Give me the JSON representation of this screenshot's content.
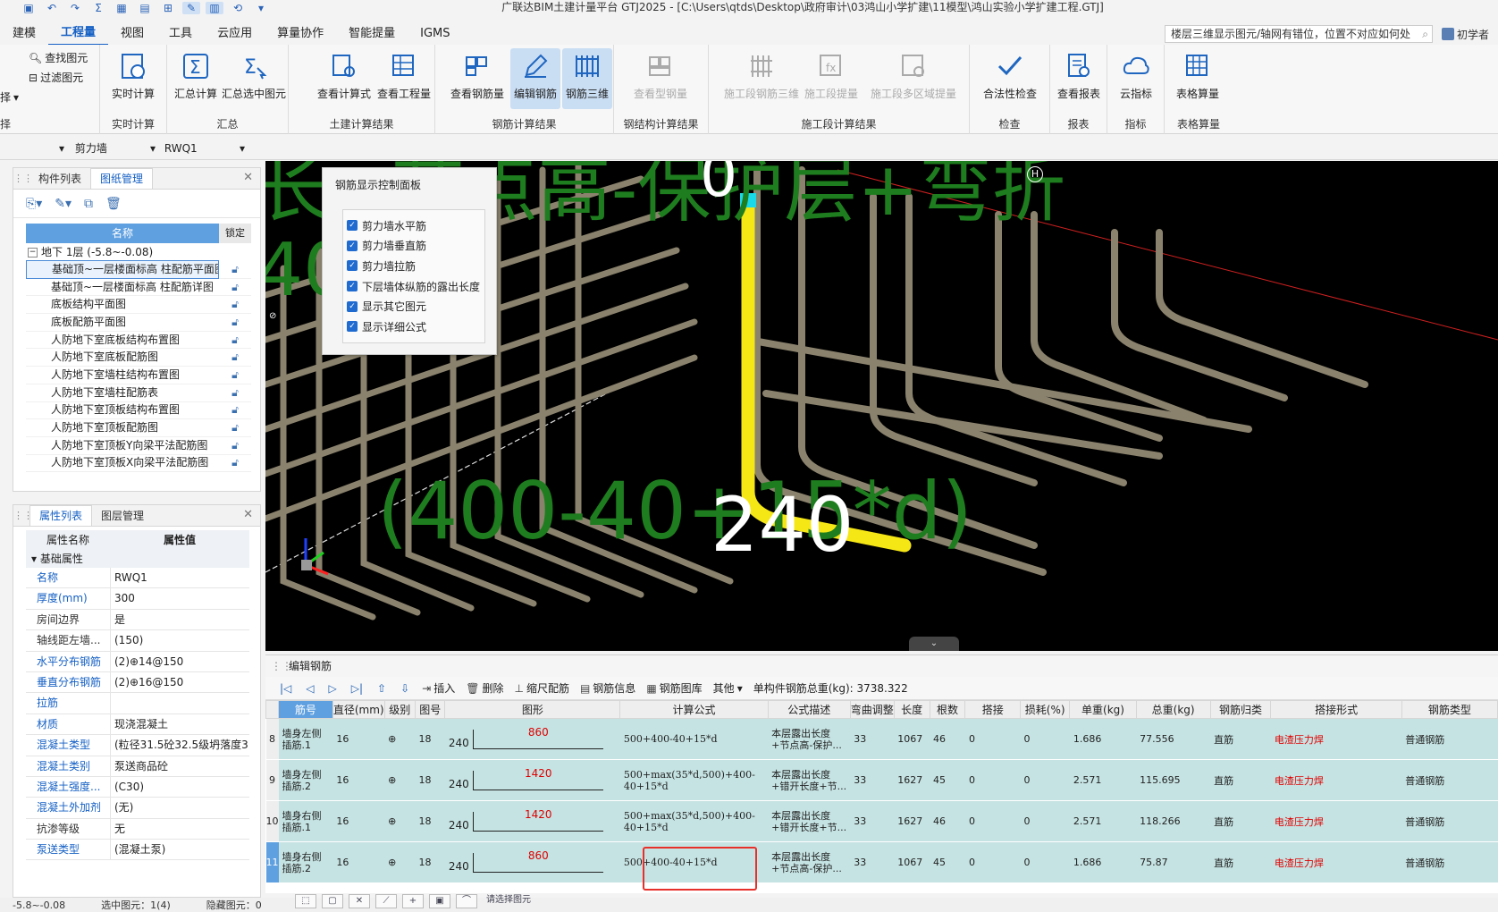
{
  "window": {
    "title": "广联达BIM土建计量平台 GTJ2025 - [C:\\Users\\qtds\\Desktop\\政府审计\\03鸿山小学扩建\\11模型\\鸿山实验小学扩建工程.GTJ]"
  },
  "menu": {
    "items": [
      "建模",
      "工程量",
      "视图",
      "工具",
      "云应用",
      "算量协作",
      "智能提量",
      "IGMS"
    ],
    "active": "工程量",
    "help_text": "楼层三维显示图元/轴网有错位，位置不对应如何处理?",
    "user": "初学者"
  },
  "ribbon": {
    "left_small": [
      "查找图元",
      "过滤图元"
    ],
    "left_cut": [
      "择",
      "择"
    ],
    "groups": [
      {
        "name": "实时计算",
        "buttons": [
          "实时计算"
        ]
      },
      {
        "name": "汇总",
        "buttons": [
          "汇总计算",
          "汇总选中图元"
        ]
      },
      {
        "name": "土建计算结果",
        "buttons": [
          "查看计算式",
          "查看工程量"
        ]
      },
      {
        "name": "钢筋计算结果",
        "buttons": [
          "查看钢筋量",
          "编辑钢筋",
          "钢筋三维"
        ]
      },
      {
        "name": "钢结构计算结果",
        "buttons": [
          "查看型钢量"
        ]
      },
      {
        "name": "施工段计算结果",
        "buttons": [
          "施工段钢筋三维",
          "施工段提量",
          "施工段多区域提量"
        ]
      },
      {
        "name": "检查",
        "buttons": [
          "合法性检查"
        ]
      },
      {
        "name": "报表",
        "buttons": [
          "查看报表"
        ]
      },
      {
        "name": "指标",
        "buttons": [
          "云指标"
        ]
      },
      {
        "name": "表格算量",
        "buttons": [
          "表格算量"
        ]
      }
    ]
  },
  "selector": {
    "type": "剪力墙",
    "element": "RWQ1"
  },
  "drawing_panel": {
    "tabs": [
      "构件列表",
      "图纸管理"
    ],
    "active_tab": "图纸管理",
    "col_name": "名称",
    "col_lock": "锁定",
    "floor": "地下 1层 (-5.8~-0.08)",
    "drawings": [
      "基础顶~一层楼面标高 柱配筋平面图",
      "基础顶~一层楼面标高 柱配筋详图",
      "底板结构平面图",
      "底板配筋平面图",
      "人防地下室底板结构布置图",
      "人防地下室底板配筋图",
      "人防地下室墙柱结构布置图",
      "人防地下室墙柱配筋表",
      "人防地下室顶板结构布置图",
      "人防地下室顶板配筋图",
      "人防地下室顶板Y向梁平法配筋图",
      "人防地下室顶板X向梁平法配筋图"
    ]
  },
  "property_panel": {
    "tabs": [
      "属性列表",
      "图层管理"
    ],
    "active_tab": "属性列表",
    "col_name": "属性名称",
    "col_value": "属性值",
    "group": "基础属性",
    "rows": [
      {
        "k": "名称",
        "v": "RWQ1",
        "blue": true
      },
      {
        "k": "厚度(mm)",
        "v": "300",
        "blue": true
      },
      {
        "k": "房间边界",
        "v": "是",
        "blue": false
      },
      {
        "k": "轴线距左墙...",
        "v": "(150)",
        "blue": false
      },
      {
        "k": "水平分布钢筋",
        "v": "(2)⊕14@150",
        "blue": true
      },
      {
        "k": "垂直分布钢筋",
        "v": "(2)⊕16@150",
        "blue": true
      },
      {
        "k": "拉筋",
        "v": "",
        "blue": true
      },
      {
        "k": "材质",
        "v": "现浇混凝土",
        "blue": true
      },
      {
        "k": "混凝土类型",
        "v": "(粒径31.5砼32.5级坍落度3...",
        "blue": true
      },
      {
        "k": "混凝土类别",
        "v": "泵送商品砼",
        "blue": true
      },
      {
        "k": "混凝土强度...",
        "v": "(C30)",
        "blue": true
      },
      {
        "k": "混凝土外加剂",
        "v": "(无)",
        "blue": true
      },
      {
        "k": "抗渗等级",
        "v": "无",
        "blue": false
      },
      {
        "k": "泵送类型",
        "v": "(混凝土泵)",
        "blue": true
      }
    ]
  },
  "viewport": {
    "overlay_line1": "长+节点高-保护层+弯折",
    "overlay_line2": "40*d",
    "overlay_line3": "(400-40+15*d)",
    "value_label": "240",
    "top_value": "0",
    "corner_marker": "H"
  },
  "control_panel": {
    "title": "钢筋显示控制面板",
    "options": [
      "剪力墙水平筋",
      "剪力墙垂直筋",
      "剪力墙拉筋",
      "下层墙体纵筋的露出长度",
      "显示其它图元",
      "显示详细公式"
    ]
  },
  "editor": {
    "title": "编辑钢筋",
    "tools": [
      "插入",
      "删除",
      "缩尺配筋",
      "钢筋信息",
      "钢筋图库",
      "其他"
    ],
    "total_label": "单构件钢筋总重(kg): 3738.322",
    "columns": [
      "筋号",
      "直径(mm)",
      "级别",
      "图号",
      "图形",
      "计算公式",
      "公式描述",
      "弯曲调整",
      "长度",
      "根数",
      "搭接",
      "损耗(%)",
      "单重(kg)",
      "总重(kg)",
      "钢筋归类",
      "搭接形式",
      "钢筋类型"
    ],
    "rows": [
      {
        "no": "8",
        "name": "墙身左侧插筋.1",
        "dia": "16",
        "grade": "⊕",
        "fig": "18",
        "w": "240",
        "len_label": "860",
        "formula": "500+400-40+15*d",
        "desc": "本层露出长度+节点高-保护...",
        "bend": "33",
        "length": "1067",
        "count": "46",
        "lap": "0",
        "loss": "0",
        "unit": "1.686",
        "total": "77.556",
        "cls": "直筋",
        "lapform": "电渣压力焊",
        "type": "普通钢筋"
      },
      {
        "no": "9",
        "name": "墙身左侧插筋.2",
        "dia": "16",
        "grade": "⊕",
        "fig": "18",
        "w": "240",
        "len_label": "1420",
        "formula": "500+max(35*d,500)+400-40+15*d",
        "desc": "本层露出长度+错开长度+节...",
        "bend": "33",
        "length": "1627",
        "count": "45",
        "lap": "0",
        "loss": "0",
        "unit": "2.571",
        "total": "115.695",
        "cls": "直筋",
        "lapform": "电渣压力焊",
        "type": "普通钢筋"
      },
      {
        "no": "10",
        "name": "墙身右侧插筋.1",
        "dia": "16",
        "grade": "⊕",
        "fig": "18",
        "w": "240",
        "len_label": "1420",
        "formula": "500+max(35*d,500)+400-40+15*d",
        "desc": "本层露出长度+错开长度+节...",
        "bend": "33",
        "length": "1627",
        "count": "46",
        "lap": "0",
        "loss": "0",
        "unit": "2.571",
        "total": "118.266",
        "cls": "直筋",
        "lapform": "电渣压力焊",
        "type": "普通钢筋"
      },
      {
        "no": "11",
        "name": "墙身右侧插筋.2",
        "dia": "16",
        "grade": "⊕",
        "fig": "18",
        "w": "240",
        "len_label": "860",
        "formula": "500+400-40+15*d",
        "desc": "本层露出长度+节点高-保护...",
        "bend": "33",
        "length": "1067",
        "count": "45",
        "lap": "0",
        "loss": "0",
        "unit": "1.686",
        "total": "75.87",
        "cls": "直筋",
        "lapform": "电渣压力焊",
        "type": "普通钢筋"
      }
    ]
  },
  "statusbar": {
    "floor": "-5.8~-0.08",
    "selected": "选中图元：1(4)",
    "hidden": "隐藏图元：0",
    "hint": "请选择图元"
  },
  "colors": {
    "accent": "#1560c4",
    "overlay_green": "#1e7d1e",
    "rebar_yellow": "#f5e616",
    "row_bg": "#c6e3e3",
    "highlight": "#e8302a"
  }
}
